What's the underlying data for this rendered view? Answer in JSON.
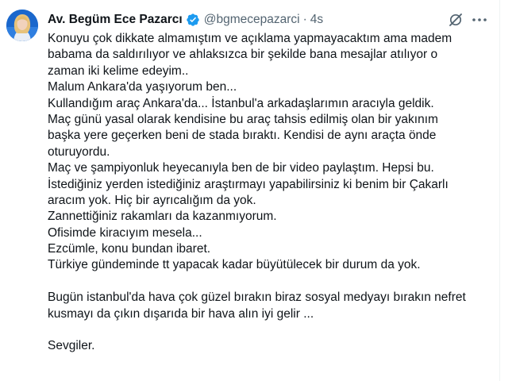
{
  "author": {
    "name": "Av. Begüm Ece Pazarcı",
    "handle": "@bgmecepazarci",
    "separator": "·",
    "time": "4s"
  },
  "icons": {
    "verified": "verified-badge-icon",
    "grok": "grok-icon",
    "more": "more-horizontal-icon"
  },
  "colors": {
    "verified": "#1d9bf0",
    "secondary_text": "#536471"
  },
  "tweet": {
    "lines": [
      "Konuyu çok dikkate almamıştım ve açıklama yapmayacaktım ama madem",
      "babama da saldırılıyor ve ahlaksızca bir şekilde bana mesajlar atılıyor o",
      "zaman iki kelime edeyim..",
      "Malum Ankara'da yaşıyorum ben...",
      "Kullandığım araç Ankara'da... İstanbul'a arkadaşlarımın aracıyla geldik.",
      "Maç günü yasal olarak kendisine bu araç tahsis edilmiş olan bir yakınım",
      "başka yere geçerken beni de stada bıraktı. Kendisi de aynı araçta önde",
      "oturuyordu.",
      "Maç ve şampiyonluk heyecanıyla ben de bir video paylaştım. Hepsi bu.",
      "İstediğiniz yerden istediğiniz araştırmayı yapabilirsiniz ki benim bir Çakarlı",
      "aracım yok. Hiç bir ayrıcalığım da yok.",
      "Zannettiğiniz rakamları da kazanmıyorum.",
      "Ofisimde kiracıyım mesela...",
      "Ezcümle, konu bundan ibaret.",
      "Türkiye gündeminde tt yapacak kadar büyütülecek bir durum da yok.",
      "",
      "Bugün istanbul'da hava çok güzel bırakın biraz sosyal medyayı bırakın nefret",
      "kusmayı da çıkın dışarıda bir hava alın iyi gelir ...",
      "",
      "Sevgiler."
    ]
  }
}
